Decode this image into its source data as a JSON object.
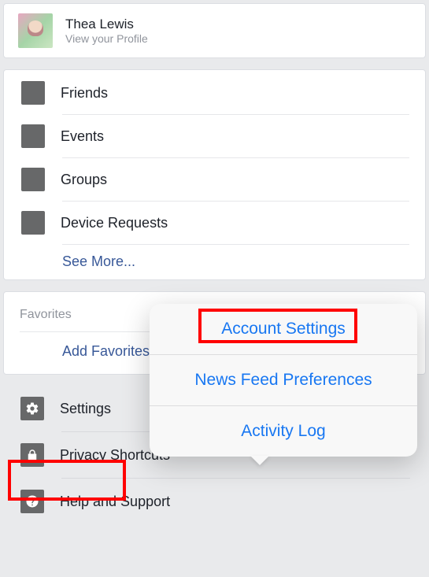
{
  "profile": {
    "name": "Thea Lewis",
    "subtitle": "View your Profile"
  },
  "shortcuts": {
    "items": [
      {
        "label": "Friends"
      },
      {
        "label": "Events"
      },
      {
        "label": "Groups"
      },
      {
        "label": "Device Requests"
      }
    ],
    "see_more_label": "See More..."
  },
  "favorites": {
    "header": "Favorites",
    "add_label": "Add Favorites..."
  },
  "bottom": {
    "items": [
      {
        "label": "Settings",
        "icon": "gear-icon"
      },
      {
        "label": "Privacy Shortcuts",
        "icon": "lock-icon"
      },
      {
        "label": "Help and Support",
        "icon": "help-icon"
      }
    ]
  },
  "popover": {
    "items": [
      {
        "label": "Account Settings"
      },
      {
        "label": "News Feed Preferences"
      },
      {
        "label": "Activity Log"
      }
    ]
  }
}
